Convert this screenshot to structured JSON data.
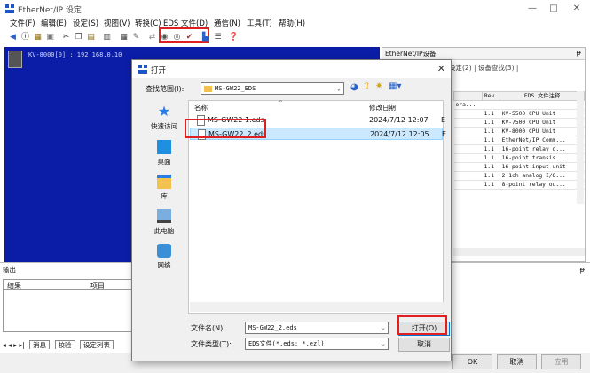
{
  "window": {
    "title": "EtherNet/IP 设定",
    "controls": {
      "minimize": "—",
      "maximize": "□",
      "close": "✕"
    }
  },
  "menu": [
    "文件(F)",
    "编辑(E)",
    "设定(S)",
    "视图(V)",
    "转换(C)",
    "EDS 文件(D)",
    "通信(N)",
    "工具(T)",
    "帮助(H)"
  ],
  "left_panel": {
    "device_text": "KV-8000[0] : 192.168.0.10"
  },
  "right_panel": {
    "title": "EtherNet/IP设备",
    "pin": "ᵽ",
    "tabs": "设定(2)  |  设备查找(3)  |",
    "columns": [
      "",
      "Rev.",
      "EDS 文件注释"
    ],
    "rows": [
      {
        "name": "ora...",
        "rev": "",
        "comment": ""
      },
      {
        "name": "",
        "rev": "1.1",
        "comment": "KV-5500 CPU Unit"
      },
      {
        "name": "",
        "rev": "1.1",
        "comment": "KV-7500 CPU Unit"
      },
      {
        "name": "",
        "rev": "1.1",
        "comment": "KV-8000 CPU Unit"
      },
      {
        "name": "",
        "rev": "1.1",
        "comment": "EtherNet/IP Comm..."
      },
      {
        "name": "",
        "rev": "1.1",
        "comment": "16-point relay o..."
      },
      {
        "name": "",
        "rev": "1.1",
        "comment": "16-point transis..."
      },
      {
        "name": "",
        "rev": "1.1",
        "comment": "16-point input unit"
      },
      {
        "name": "",
        "rev": "1.1",
        "comment": "2+1ch analog I/O..."
      },
      {
        "name": "",
        "rev": "1.1",
        "comment": "8-point relay ou..."
      }
    ]
  },
  "output_panel": {
    "title": "输出",
    "pin": "ᵽ",
    "columns": [
      "结果",
      "项目"
    ],
    "nav": "◂ ◂ ▸ ▸|",
    "tabs": [
      "消息",
      "校验",
      "设定列表"
    ]
  },
  "bottom_buttons": {
    "ok": "OK",
    "cancel": "取消",
    "apply": "应用"
  },
  "dialog": {
    "title": "打开",
    "close": "✕",
    "lookin_label": "查找范围(I):",
    "lookin_value": "MS-GW22_EDS",
    "places": [
      "快速访问",
      "桌面",
      "库",
      "此电脑",
      "网络"
    ],
    "col_name": "名称",
    "col_date": "修改日期",
    "files": [
      {
        "name": "MS-GW22 1.eds",
        "date": "2024/7/12 12:07",
        "cut": "E"
      },
      {
        "name": "MS-GW22_2.eds",
        "date": "2024/7/12 12:05",
        "cut": "E"
      }
    ],
    "filename_label": "文件名(N):",
    "filename_value": "MS-GW22_2.eds",
    "filetype_label": "文件类型(T):",
    "filetype_value": "EDS文件(*.eds; *.ezl)",
    "open_button": "打开(O)",
    "cancel_button": "取消"
  },
  "colors": {
    "workspace": "#0b1da6",
    "highlight": "#e02020",
    "selection": "#cce8ff"
  }
}
